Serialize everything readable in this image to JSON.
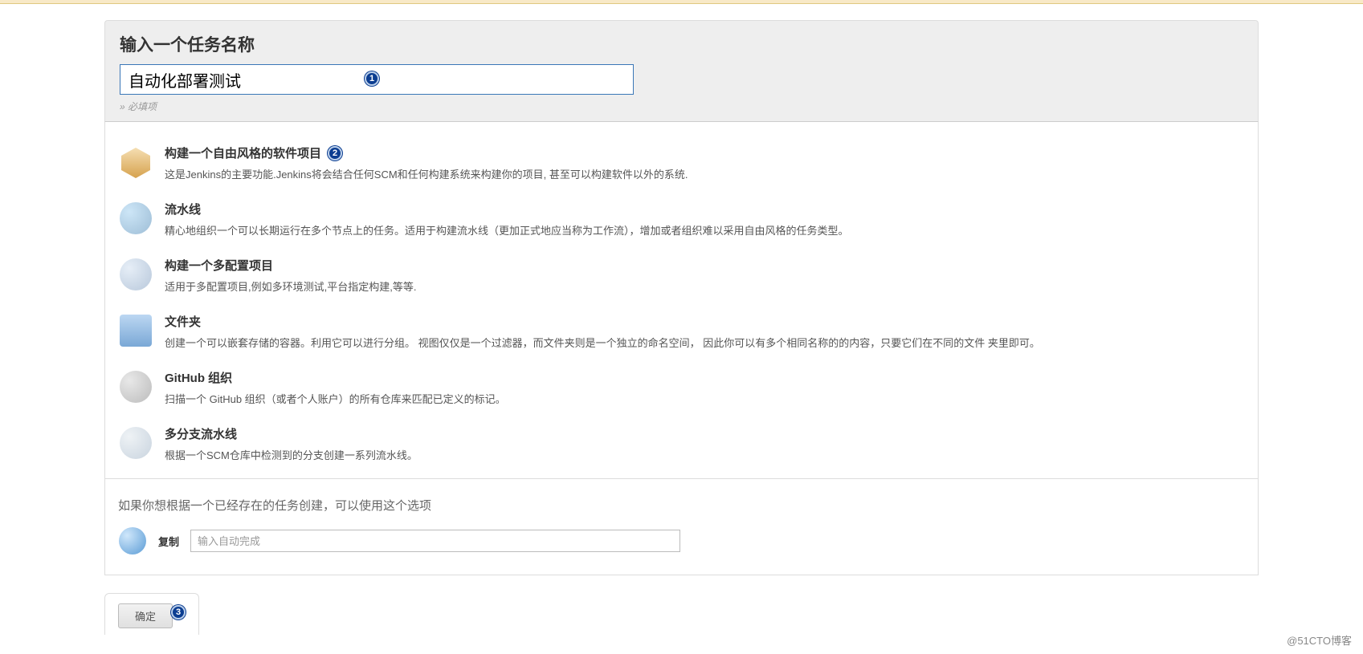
{
  "header": {
    "title": "输入一个任务名称",
    "required_note": "» 必填项"
  },
  "form": {
    "item_name_value": "自动化部署测试"
  },
  "callouts": {
    "c1": "1",
    "c2": "2",
    "c3": "3"
  },
  "options": [
    {
      "icon": "box-icon",
      "title": "构建一个自由风格的软件项目",
      "desc": "这是Jenkins的主要功能.Jenkins将会结合任何SCM和任何构建系统来构建你的项目, 甚至可以构建软件以外的系统.",
      "has_callout2": true
    },
    {
      "icon": "pipeline-icon",
      "title": "流水线",
      "desc": "精心地组织一个可以长期运行在多个节点上的任务。适用于构建流水线（更加正式地应当称为工作流），增加或者组织难以采用自由风格的任务类型。"
    },
    {
      "icon": "multiconfig-icon",
      "title": "构建一个多配置项目",
      "desc": "适用于多配置项目,例如多环境测试,平台指定构建,等等."
    },
    {
      "icon": "folder-icon",
      "title": "文件夹",
      "desc": "创建一个可以嵌套存储的容器。利用它可以进行分组。 视图仅仅是一个过滤器，而文件夹则是一个独立的命名空间， 因此你可以有多个相同名称的的内容，只要它们在不同的文件 夹里即可。"
    },
    {
      "icon": "github-icon",
      "title": "GitHub 组织",
      "desc": "扫描一个 GitHub 组织（或者个人账户）的所有仓库来匹配已定义的标记。"
    },
    {
      "icon": "multibranch-icon",
      "title": "多分支流水线",
      "desc": "根据一个SCM仓库中检测到的分支创建一系列流水线。"
    }
  ],
  "copy": {
    "hint": "如果你想根据一个已经存在的任务创建，可以使用这个选项",
    "label": "复制",
    "placeholder": "输入自动完成"
  },
  "footer": {
    "ok_label": "确定"
  },
  "watermark": "@51CTO博客"
}
